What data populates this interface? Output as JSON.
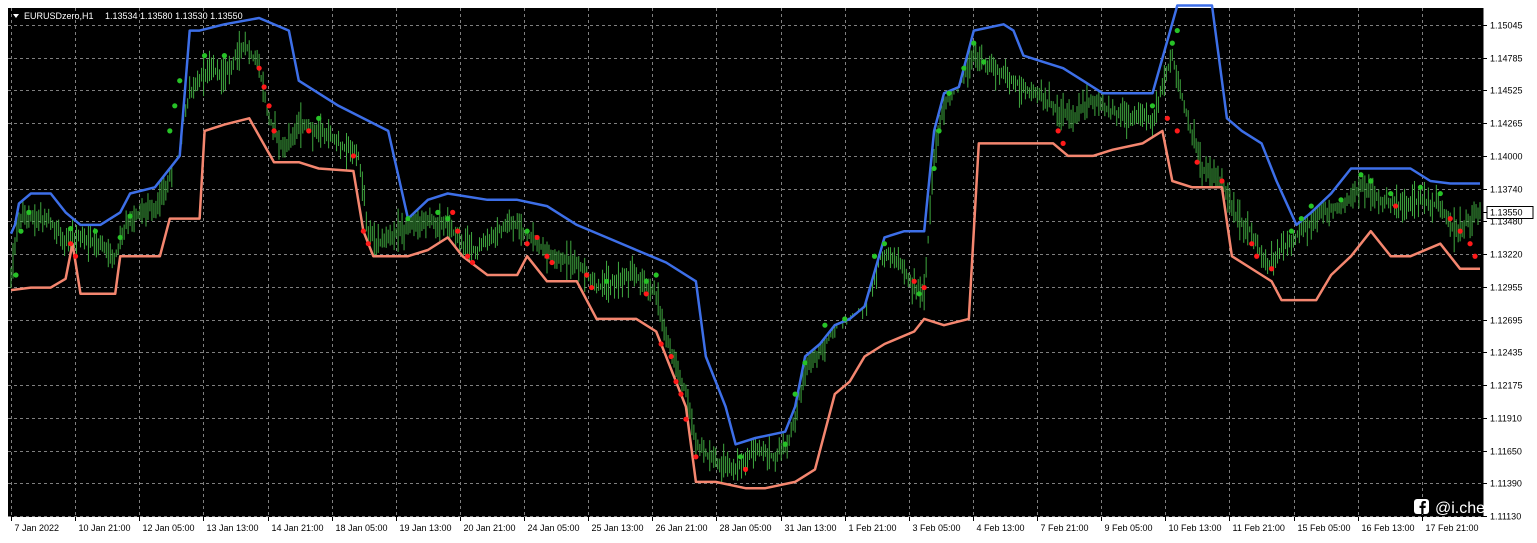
{
  "header": {
    "symbol": "EURUSDzero,H1",
    "ohlc": "1.13534 1.13580 1.13530 1.13550"
  },
  "watermark": {
    "icon": "facebook-icon",
    "text": "@i.chen"
  },
  "colors": {
    "background": "#000000",
    "grid": "#7f7f7f",
    "bars": "#3fa83f",
    "upper_band": "#3d6fe8",
    "lower_band": "#f4866f",
    "dot_up": "#27c227",
    "dot_down": "#ff1a1a"
  },
  "chart_data": {
    "type": "line",
    "title": "EURUSDzero,H1",
    "price_ticks": [
      1.15045,
      1.14785,
      1.14525,
      1.14265,
      1.14,
      1.1374,
      1.1348,
      1.1322,
      1.12955,
      1.12695,
      1.12435,
      1.12175,
      1.1191,
      1.1165,
      1.1139,
      1.1113
    ],
    "ylim": [
      1.1112,
      1.1518
    ],
    "current_price": 1.1355,
    "time_labels": [
      "7 Jan 2022",
      "10 Jan 21:00",
      "12 Jan 05:00",
      "13 Jan 13:00",
      "14 Jan 21:00",
      "18 Jan 05:00",
      "19 Jan 13:00",
      "20 Jan 21:00",
      "24 Jan 05:00",
      "25 Jan 13:00",
      "26 Jan 21:00",
      "28 Jan 05:00",
      "31 Jan 13:00",
      "1 Feb 21:00",
      "3 Feb 05:00",
      "4 Feb 13:00",
      "7 Feb 21:00",
      "9 Feb 05:00",
      "10 Feb 13:00",
      "11 Feb 21:00",
      "15 Feb 05:00",
      "16 Feb 13:00",
      "17 Feb 21:00"
    ],
    "grid": true,
    "series": [
      {
        "kind": "upper",
        "points": [
          [
            0,
            1.1338
          ],
          [
            4,
            1.1345
          ],
          [
            8,
            1.1362
          ],
          [
            20,
            1.137
          ],
          [
            40,
            1.137
          ],
          [
            55,
            1.1355
          ],
          [
            70,
            1.1345
          ],
          [
            90,
            1.1345
          ],
          [
            110,
            1.1355
          ],
          [
            120,
            1.137
          ],
          [
            145,
            1.1375
          ],
          [
            170,
            1.14
          ],
          [
            175,
            1.145
          ],
          [
            180,
            1.15
          ],
          [
            190,
            1.15
          ],
          [
            215,
            1.1505
          ],
          [
            250,
            1.151
          ],
          [
            280,
            1.15
          ],
          [
            290,
            1.146
          ],
          [
            330,
            1.144
          ],
          [
            380,
            1.142
          ],
          [
            400,
            1.135
          ],
          [
            420,
            1.1365
          ],
          [
            440,
            1.137
          ],
          [
            480,
            1.1365
          ],
          [
            510,
            1.1365
          ],
          [
            540,
            1.136
          ],
          [
            570,
            1.1345
          ],
          [
            600,
            1.1335
          ],
          [
            630,
            1.1325
          ],
          [
            660,
            1.1315
          ],
          [
            690,
            1.13
          ],
          [
            700,
            1.124
          ],
          [
            710,
            1.122
          ],
          [
            720,
            1.12
          ],
          [
            730,
            1.117
          ],
          [
            750,
            1.1175
          ],
          [
            780,
            1.118
          ],
          [
            790,
            1.12
          ],
          [
            800,
            1.124
          ],
          [
            815,
            1.125
          ],
          [
            830,
            1.1265
          ],
          [
            845,
            1.127
          ],
          [
            860,
            1.128
          ],
          [
            880,
            1.1335
          ],
          [
            900,
            1.134
          ],
          [
            920,
            1.134
          ],
          [
            930,
            1.142
          ],
          [
            940,
            1.145
          ],
          [
            955,
            1.1455
          ],
          [
            970,
            1.15
          ],
          [
            1000,
            1.1505
          ],
          [
            1010,
            1.15
          ],
          [
            1020,
            1.148
          ],
          [
            1040,
            1.1475
          ],
          [
            1060,
            1.147
          ],
          [
            1080,
            1.146
          ],
          [
            1100,
            1.145
          ],
          [
            1120,
            1.145
          ],
          [
            1150,
            1.145
          ],
          [
            1175,
            1.152
          ],
          [
            1210,
            1.152
          ],
          [
            1225,
            1.143
          ],
          [
            1240,
            1.142
          ],
          [
            1260,
            1.141
          ],
          [
            1275,
            1.138
          ],
          [
            1295,
            1.1345
          ],
          [
            1310,
            1.1355
          ],
          [
            1330,
            1.137
          ],
          [
            1350,
            1.139
          ],
          [
            1380,
            1.139
          ],
          [
            1410,
            1.139
          ],
          [
            1430,
            1.138
          ],
          [
            1450,
            1.1378
          ],
          [
            1480,
            1.1378
          ]
        ]
      },
      {
        "kind": "lower",
        "points": [
          [
            0,
            1.1293
          ],
          [
            20,
            1.1295
          ],
          [
            40,
            1.1295
          ],
          [
            55,
            1.1302
          ],
          [
            62,
            1.133
          ],
          [
            70,
            1.129
          ],
          [
            90,
            1.129
          ],
          [
            105,
            1.129
          ],
          [
            110,
            1.132
          ],
          [
            150,
            1.132
          ],
          [
            160,
            1.135
          ],
          [
            190,
            1.135
          ],
          [
            195,
            1.142
          ],
          [
            215,
            1.1425
          ],
          [
            240,
            1.143
          ],
          [
            265,
            1.1395
          ],
          [
            290,
            1.1395
          ],
          [
            310,
            1.139
          ],
          [
            345,
            1.1388
          ],
          [
            355,
            1.134
          ],
          [
            365,
            1.132
          ],
          [
            400,
            1.132
          ],
          [
            420,
            1.1325
          ],
          [
            440,
            1.1335
          ],
          [
            455,
            1.132
          ],
          [
            480,
            1.1305
          ],
          [
            510,
            1.1305
          ],
          [
            520,
            1.132
          ],
          [
            540,
            1.13
          ],
          [
            570,
            1.13
          ],
          [
            590,
            1.127
          ],
          [
            630,
            1.127
          ],
          [
            650,
            1.126
          ],
          [
            660,
            1.124
          ],
          [
            680,
            1.12
          ],
          [
            690,
            1.114
          ],
          [
            710,
            1.114
          ],
          [
            740,
            1.1135
          ],
          [
            760,
            1.1135
          ],
          [
            790,
            1.114
          ],
          [
            810,
            1.115
          ],
          [
            830,
            1.121
          ],
          [
            845,
            1.122
          ],
          [
            860,
            1.124
          ],
          [
            880,
            1.125
          ],
          [
            910,
            1.126
          ],
          [
            920,
            1.127
          ],
          [
            940,
            1.1265
          ],
          [
            965,
            1.127
          ],
          [
            975,
            1.141
          ],
          [
            1000,
            1.141
          ],
          [
            1020,
            1.141
          ],
          [
            1050,
            1.141
          ],
          [
            1065,
            1.14
          ],
          [
            1090,
            1.14
          ],
          [
            1110,
            1.1405
          ],
          [
            1140,
            1.141
          ],
          [
            1160,
            1.142
          ],
          [
            1170,
            1.138
          ],
          [
            1190,
            1.1375
          ],
          [
            1220,
            1.1375
          ],
          [
            1230,
            1.132
          ],
          [
            1260,
            1.1305
          ],
          [
            1270,
            1.13
          ],
          [
            1280,
            1.1285
          ],
          [
            1315,
            1.1285
          ],
          [
            1330,
            1.1305
          ],
          [
            1350,
            1.132
          ],
          [
            1370,
            1.134
          ],
          [
            1390,
            1.132
          ],
          [
            1410,
            1.132
          ],
          [
            1440,
            1.133
          ],
          [
            1460,
            1.131
          ],
          [
            1480,
            1.131
          ]
        ]
      },
      {
        "kind": "mid",
        "points": [
          [
            0,
            1.1305
          ],
          [
            8,
            1.135
          ],
          [
            20,
            1.1352
          ],
          [
            40,
            1.1348
          ],
          [
            55,
            1.133
          ],
          [
            70,
            1.1335
          ],
          [
            90,
            1.133
          ],
          [
            105,
            1.132
          ],
          [
            115,
            1.1345
          ],
          [
            130,
            1.1355
          ],
          [
            150,
            1.1362
          ],
          [
            165,
            1.14
          ],
          [
            180,
            1.145
          ],
          [
            200,
            1.147
          ],
          [
            215,
            1.1465
          ],
          [
            235,
            1.149
          ],
          [
            250,
            1.147
          ],
          [
            260,
            1.143
          ],
          [
            275,
            1.1405
          ],
          [
            290,
            1.1425
          ],
          [
            310,
            1.142
          ],
          [
            330,
            1.141
          ],
          [
            350,
            1.14
          ],
          [
            360,
            1.134
          ],
          [
            370,
            1.133
          ],
          [
            400,
            1.1345
          ],
          [
            420,
            1.135
          ],
          [
            440,
            1.1345
          ],
          [
            455,
            1.133
          ],
          [
            470,
            1.1325
          ],
          [
            490,
            1.134
          ],
          [
            510,
            1.1345
          ],
          [
            530,
            1.133
          ],
          [
            545,
            1.132
          ],
          [
            570,
            1.1315
          ],
          [
            590,
            1.1295
          ],
          [
            610,
            1.13
          ],
          [
            630,
            1.1305
          ],
          [
            650,
            1.129
          ],
          [
            660,
            1.1255
          ],
          [
            680,
            1.121
          ],
          [
            690,
            1.117
          ],
          [
            710,
            1.1155
          ],
          [
            730,
            1.115
          ],
          [
            750,
            1.1165
          ],
          [
            770,
            1.116
          ],
          [
            785,
            1.1175
          ],
          [
            800,
            1.123
          ],
          [
            820,
            1.125
          ],
          [
            840,
            1.1275
          ],
          [
            860,
            1.1285
          ],
          [
            875,
            1.132
          ],
          [
            890,
            1.132
          ],
          [
            905,
            1.13
          ],
          [
            920,
            1.129
          ],
          [
            930,
            1.14
          ],
          [
            940,
            1.144
          ],
          [
            955,
            1.146
          ],
          [
            970,
            1.148
          ],
          [
            990,
            1.147
          ],
          [
            1010,
            1.146
          ],
          [
            1030,
            1.145
          ],
          [
            1050,
            1.144
          ],
          [
            1070,
            1.143
          ],
          [
            1090,
            1.1445
          ],
          [
            1110,
            1.1435
          ],
          [
            1130,
            1.143
          ],
          [
            1150,
            1.143
          ],
          [
            1170,
            1.148
          ],
          [
            1185,
            1.143
          ],
          [
            1200,
            1.139
          ],
          [
            1220,
            1.138
          ],
          [
            1235,
            1.135
          ],
          [
            1250,
            1.134
          ],
          [
            1265,
            1.131
          ],
          [
            1280,
            1.1325
          ],
          [
            1300,
            1.134
          ],
          [
            1320,
            1.1355
          ],
          [
            1340,
            1.136
          ],
          [
            1360,
            1.1375
          ],
          [
            1380,
            1.1365
          ],
          [
            1400,
            1.136
          ],
          [
            1420,
            1.1365
          ],
          [
            1440,
            1.136
          ],
          [
            1455,
            1.134
          ],
          [
            1470,
            1.135
          ],
          [
            1480,
            1.1355
          ]
        ]
      }
    ],
    "dots_up": [
      [
        5,
        1.1305
      ],
      [
        10,
        1.134
      ],
      [
        18,
        1.1355
      ],
      [
        60,
        1.1342
      ],
      [
        85,
        1.134
      ],
      [
        110,
        1.1335
      ],
      [
        120,
        1.1352
      ],
      [
        160,
        1.142
      ],
      [
        165,
        1.144
      ],
      [
        170,
        1.146
      ],
      [
        195,
        1.148
      ],
      [
        215,
        1.148
      ],
      [
        310,
        1.143
      ],
      [
        400,
        1.135
      ],
      [
        430,
        1.1355
      ],
      [
        440,
        1.135
      ],
      [
        520,
        1.134
      ],
      [
        600,
        1.13
      ],
      [
        640,
        1.13
      ],
      [
        650,
        1.1305
      ],
      [
        735,
        1.116
      ],
      [
        780,
        1.117
      ],
      [
        790,
        1.121
      ],
      [
        800,
        1.1235
      ],
      [
        820,
        1.1265
      ],
      [
        840,
        1.127
      ],
      [
        870,
        1.132
      ],
      [
        880,
        1.133
      ],
      [
        915,
        1.129
      ],
      [
        930,
        1.139
      ],
      [
        935,
        1.142
      ],
      [
        945,
        1.145
      ],
      [
        960,
        1.147
      ],
      [
        970,
        1.149
      ],
      [
        980,
        1.1475
      ],
      [
        1150,
        1.144
      ],
      [
        1170,
        1.149
      ],
      [
        1175,
        1.15
      ],
      [
        1290,
        1.134
      ],
      [
        1300,
        1.135
      ],
      [
        1310,
        1.136
      ],
      [
        1340,
        1.1365
      ],
      [
        1360,
        1.1385
      ],
      [
        1370,
        1.138
      ],
      [
        1390,
        1.137
      ],
      [
        1420,
        1.1375
      ],
      [
        1440,
        1.137
      ]
    ],
    "dots_down": [
      [
        60,
        1.133
      ],
      [
        65,
        1.132
      ],
      [
        250,
        1.147
      ],
      [
        255,
        1.1455
      ],
      [
        260,
        1.144
      ],
      [
        265,
        1.142
      ],
      [
        300,
        1.142
      ],
      [
        345,
        1.14
      ],
      [
        355,
        1.134
      ],
      [
        360,
        1.133
      ],
      [
        445,
        1.1355
      ],
      [
        450,
        1.134
      ],
      [
        460,
        1.132
      ],
      [
        465,
        1.1315
      ],
      [
        520,
        1.133
      ],
      [
        530,
        1.1335
      ],
      [
        540,
        1.132
      ],
      [
        545,
        1.1315
      ],
      [
        580,
        1.1305
      ],
      [
        585,
        1.1295
      ],
      [
        640,
        1.129
      ],
      [
        655,
        1.125
      ],
      [
        665,
        1.124
      ],
      [
        670,
        1.122
      ],
      [
        675,
        1.121
      ],
      [
        680,
        1.119
      ],
      [
        690,
        1.116
      ],
      [
        740,
        1.115
      ],
      [
        910,
        1.13
      ],
      [
        920,
        1.1295
      ],
      [
        1055,
        1.142
      ],
      [
        1060,
        1.141
      ],
      [
        1165,
        1.143
      ],
      [
        1175,
        1.142
      ],
      [
        1195,
        1.1395
      ],
      [
        1220,
        1.138
      ],
      [
        1250,
        1.133
      ],
      [
        1255,
        1.132
      ],
      [
        1270,
        1.131
      ],
      [
        1395,
        1.136
      ],
      [
        1450,
        1.135
      ],
      [
        1460,
        1.134
      ],
      [
        1470,
        1.133
      ],
      [
        1475,
        1.132
      ]
    ]
  }
}
